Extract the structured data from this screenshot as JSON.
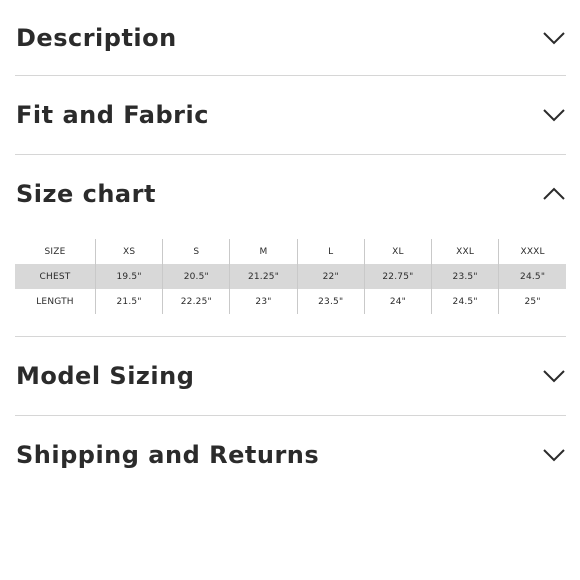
{
  "sections": [
    {
      "title": "Description",
      "expanded": false,
      "icon": "chevron-down-icon"
    },
    {
      "title": "Fit and Fabric",
      "expanded": false,
      "icon": "chevron-down-icon"
    },
    {
      "title": "Size chart",
      "expanded": true,
      "icon": "chevron-up-icon"
    },
    {
      "title": "Model Sizing",
      "expanded": false,
      "icon": "chevron-down-icon"
    },
    {
      "title": "Shipping and Returns",
      "expanded": false,
      "icon": "chevron-down-icon"
    }
  ],
  "size_chart": {
    "headers": [
      "SIZE",
      "XS",
      "S",
      "M",
      "L",
      "XL",
      "XXL",
      "XXXL"
    ],
    "rows": [
      {
        "label": "CHEST",
        "values": [
          "19.5\"",
          "20.5\"",
          "21.25\"",
          "22\"",
          "22.75\"",
          "23.5\"",
          "24.5\""
        ]
      },
      {
        "label": "LENGTH",
        "values": [
          "21.5\"",
          "22.25\"",
          "23\"",
          "23.5\"",
          "24\"",
          "24.5\"",
          "25\""
        ]
      }
    ]
  },
  "colors": {
    "text": "#2b2b2b",
    "divider": "#d6d6d6",
    "row_shade": "#d8d8d8",
    "background": "#ffffff"
  }
}
